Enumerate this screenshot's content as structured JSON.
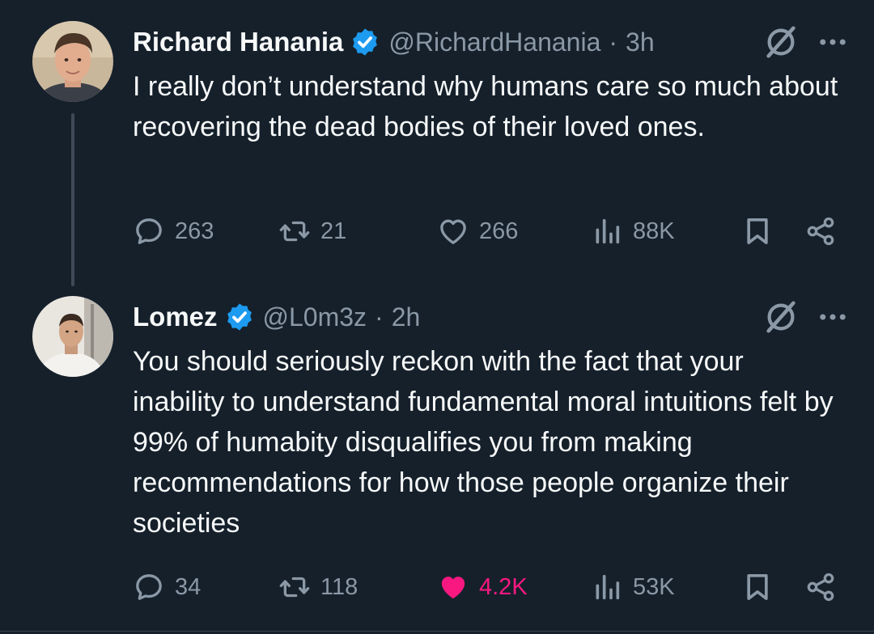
{
  "colors": {
    "background": "#15202b",
    "text_primary": "#f7f9f9",
    "text_secondary": "#8b98a5",
    "verified_blue": "#1d9bf0",
    "like_pink": "#f91880",
    "thread_line": "#3e4a56"
  },
  "tweets": [
    {
      "author": {
        "name": "Richard Hanania",
        "verified": true,
        "handle": "@RichardHanania",
        "separator": "·",
        "time": "3h"
      },
      "text": "I really don’t understand why humans care so much about recovering the dead bodies of their loved ones.",
      "stats": {
        "replies": "263",
        "retweets": "21",
        "likes": "266",
        "liked": false,
        "views": "88K"
      },
      "icons": [
        "verified-badge-icon",
        "grok-icon",
        "more-icon",
        "reply-icon",
        "retweet-icon",
        "like-icon",
        "views-icon",
        "bookmark-icon",
        "share-icon"
      ]
    },
    {
      "author": {
        "name": "Lomez",
        "verified": true,
        "handle": "@L0m3z",
        "separator": "·",
        "time": "2h"
      },
      "text": "You should seriously reckon with the fact that your inability to understand fundamental moral intuitions felt by 99% of humabity disqualifies you from making  recommendations for how those people organize their societies",
      "stats": {
        "replies": "34",
        "retweets": "118",
        "likes": "4.2K",
        "liked": true,
        "views": "53K"
      },
      "icons": [
        "verified-badge-icon",
        "grok-icon",
        "more-icon",
        "reply-icon",
        "retweet-icon",
        "like-filled-icon",
        "views-icon",
        "bookmark-icon",
        "share-icon"
      ]
    }
  ]
}
